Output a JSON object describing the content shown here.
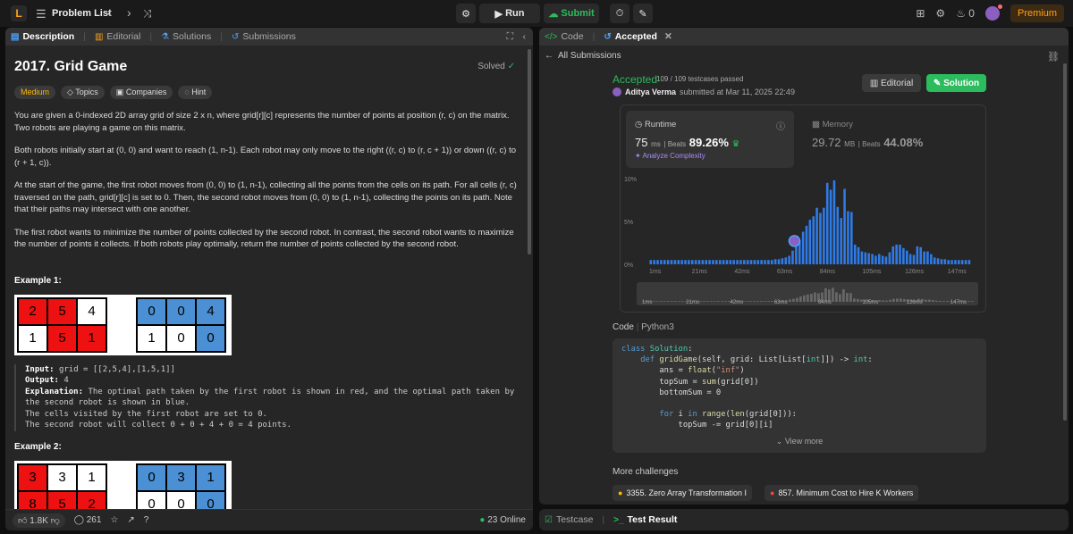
{
  "topbar": {
    "title": "Problem List",
    "run_label": "Run",
    "submit_label": "Submit",
    "streak": "0",
    "premium_label": "Premium"
  },
  "left_tabs": [
    {
      "label": "Description",
      "icon": "description-icon"
    },
    {
      "label": "Editorial",
      "icon": "book-icon"
    },
    {
      "label": "Solutions",
      "icon": "flask-icon"
    },
    {
      "label": "Submissions",
      "icon": "history-icon"
    }
  ],
  "problem": {
    "title": "2017. Grid Game",
    "status": "Solved",
    "difficulty": "Medium",
    "chips": [
      "Topics",
      "Companies",
      "Hint"
    ],
    "p1": "You are given a 0-indexed 2D array grid of size 2 x n, where grid[r][c] represents the number of points at position (r, c) on the matrix. Two robots are playing a game on this matrix.",
    "p2": "Both robots initially start at (0, 0) and want to reach (1, n-1). Each robot may only move to the right ((r, c) to (r, c + 1)) or down ((r, c) to (r + 1, c)).",
    "p3": "At the start of the game, the first robot moves from (0, 0) to (1, n-1), collecting all the points from the cells on its path. For all cells (r, c) traversed on the path, grid[r][c] is set to 0. Then, the second robot moves from (0, 0) to (1, n-1), collecting the points on its path. Note that their paths may intersect with one another.",
    "p4": "The first robot wants to minimize the number of points collected by the second robot. In contrast, the second robot wants to maximize the number of points it collects. If both robots play optimally, return the number of points collected by the second robot."
  },
  "example1": {
    "title": "Example 1:",
    "grid_left": [
      [
        "2",
        "5",
        "4"
      ],
      [
        "1",
        "5",
        "1"
      ]
    ],
    "grid_right": [
      [
        "0",
        "0",
        "4"
      ],
      [
        "1",
        "0",
        "0"
      ]
    ],
    "input": "grid = [[2,5,4],[1,5,1]]",
    "output": "4",
    "explanation": "The optimal path taken by the first robot is shown in red, and the optimal path taken by",
    "exp2": "the second robot is shown in blue.",
    "exp3": "The cells visited by the first robot are set to 0.",
    "exp4": "The second robot will collect 0 + 0 + 4 + 0 = 4 points."
  },
  "example2": {
    "title": "Example 2:",
    "grid_left": [
      [
        "3",
        "3",
        "1"
      ],
      [
        "8",
        "5",
        "2"
      ]
    ],
    "grid_right": [
      [
        "0",
        "3",
        "1"
      ],
      [
        "0",
        "0",
        "0"
      ]
    ]
  },
  "left_footer": {
    "likes": "1.8K",
    "comments": "261",
    "online": "23 Online"
  },
  "right_tabs": [
    {
      "label": "Code",
      "icon": "code-icon"
    },
    {
      "label": "Accepted",
      "icon": "history-icon"
    }
  ],
  "submission": {
    "back_label": "All Submissions",
    "status": "Accepted",
    "passed": "109 / 109 testcases passed",
    "author": "Aditya Verma",
    "submitted": "submitted at Mar 11, 2025 22:49",
    "editorial_label": "Editorial",
    "solution_label": "Solution",
    "runtime_label": "Runtime",
    "runtime_value": "75",
    "runtime_unit": "ms",
    "beats_label": "Beats",
    "runtime_beats": "89.26%",
    "analyze_label": "Analyze Complexity",
    "memory_label": "Memory",
    "memory_value": "29.72",
    "memory_unit": "MB",
    "memory_beats": "44.08%"
  },
  "chart_data": {
    "type": "bar",
    "y_ticks": [
      "10%",
      "5%",
      "0%"
    ],
    "ylim": [
      0,
      10
    ],
    "x_ticks": [
      "1ms",
      "21ms",
      "42ms",
      "63ms",
      "84ms",
      "105ms",
      "126ms",
      "147ms"
    ],
    "xlim": [
      1,
      165
    ],
    "values": [
      0.5,
      0.5,
      0.5,
      0.5,
      0.5,
      0.5,
      0.5,
      0.5,
      0.5,
      0.5,
      0.5,
      0.5,
      0.5,
      0.5,
      0.5,
      0.5,
      0.5,
      0.5,
      0.5,
      0.5,
      0.5,
      0.5,
      0.5,
      0.5,
      0.5,
      0.5,
      0.5,
      0.5,
      0.5,
      0.5,
      0.5,
      0.5,
      0.5,
      0.5,
      0.5,
      0.5,
      0.6,
      0.6,
      0.7,
      0.8,
      1.0,
      1.6,
      2.1,
      2.8,
      3.8,
      4.5,
      5.2,
      5.6,
      6.6,
      6.0,
      6.6,
      9.5,
      8.7,
      9.8,
      6.7,
      5.4,
      8.8,
      6.2,
      6.1,
      2.3,
      2.0,
      1.5,
      1.4,
      1.3,
      1.2,
      1.0,
      1.2,
      1.0,
      0.9,
      1.4,
      2.1,
      2.3,
      2.3,
      1.9,
      1.6,
      1.2,
      1.1,
      2.1,
      2.0,
      1.5,
      1.5,
      1.2,
      0.8,
      0.7,
      0.6,
      0.6,
      0.5,
      0.5,
      0.5,
      0.5,
      0.5,
      0.5,
      0.5
    ],
    "highlight_value": 75
  },
  "code": {
    "label": "Code",
    "lang": "Python3",
    "lines": [
      "class Solution:",
      "    def gridGame(self, grid: List[List[int]]) -> int:",
      "        ans = float(\"inf\")",
      "        topSum = sum(grid[0])",
      "        bottomSum = 0",
      "",
      "        for i in range(len(grid[0])):",
      "            topSum -= grid[0][i]"
    ],
    "view_more": "View more"
  },
  "more_challenges": {
    "title": "More challenges",
    "items": [
      "3355. Zero Array Transformation I",
      "857. Minimum Cost to Hire K Workers"
    ]
  },
  "bottom_tabs": [
    "Testcase",
    "Test Result"
  ]
}
